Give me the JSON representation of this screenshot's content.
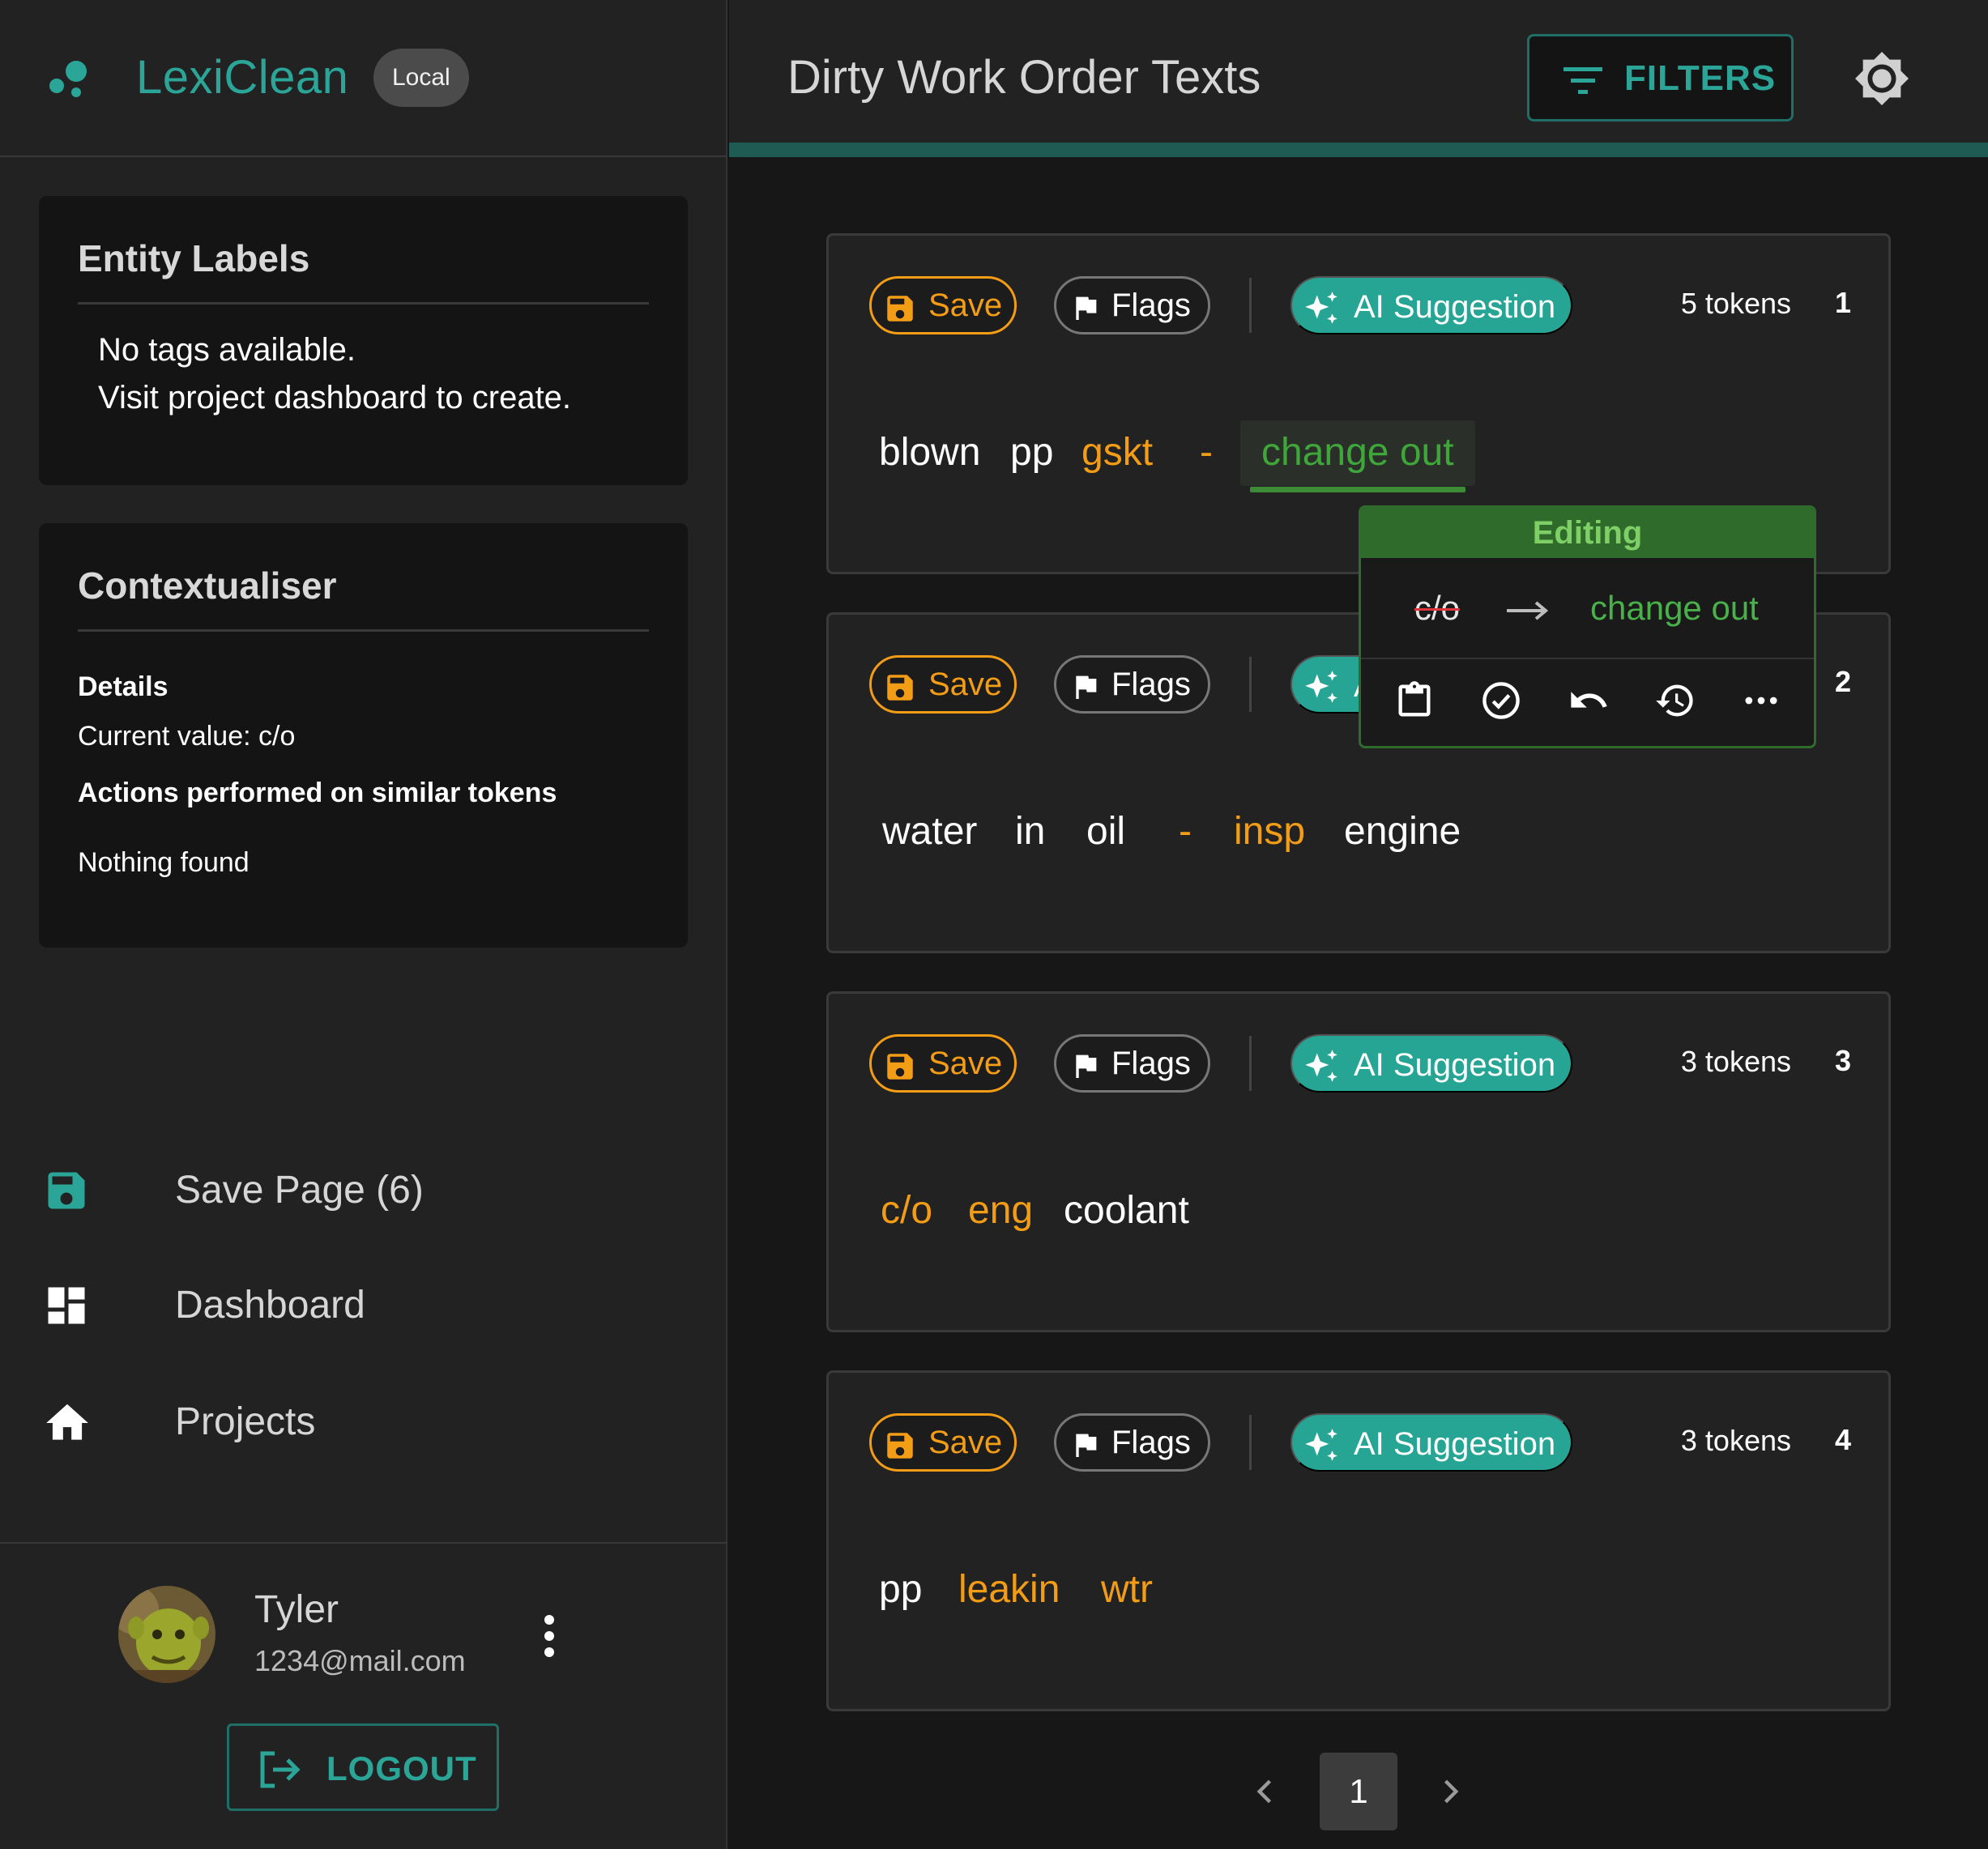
{
  "app": {
    "name": "LexiClean",
    "badge": "Local"
  },
  "header": {
    "title": "Dirty Work Order Texts",
    "filters_label": "FILTERS"
  },
  "entity_labels": {
    "title": "Entity Labels",
    "message_line1": "No tags available.",
    "message_line2": "Visit project dashboard to create."
  },
  "contextualiser": {
    "title": "Contextualiser",
    "details_heading": "Details",
    "current_value": "Current value: c/o",
    "actions_heading": "Actions performed on similar tokens",
    "actions_result": "Nothing found"
  },
  "nav": {
    "save_page": "Save Page (6)",
    "dashboard": "Dashboard",
    "projects": "Projects"
  },
  "user": {
    "name": "Tyler",
    "email": "1234@mail.com",
    "logout_label": "LOGOUT"
  },
  "card_labels": {
    "save": "Save",
    "flags": "Flags",
    "ai": "AI Suggestion"
  },
  "texts": [
    {
      "index": "1",
      "token_count": "5 tokens",
      "tokens": [
        {
          "text": "blown",
          "state": "normal"
        },
        {
          "text": "pp",
          "state": "normal"
        },
        {
          "text": "gskt",
          "state": "candidate"
        },
        {
          "text": "-",
          "state": "candidate"
        },
        {
          "text": "change out",
          "state": "editing"
        }
      ]
    },
    {
      "index": "2",
      "token_count": "",
      "tokens": [
        {
          "text": "water",
          "state": "normal"
        },
        {
          "text": "in",
          "state": "normal"
        },
        {
          "text": "oil",
          "state": "normal"
        },
        {
          "text": "-",
          "state": "candidate"
        },
        {
          "text": "insp",
          "state": "candidate"
        },
        {
          "text": "engine",
          "state": "normal"
        }
      ]
    },
    {
      "index": "3",
      "token_count": "3 tokens",
      "tokens": [
        {
          "text": "c/o",
          "state": "candidate"
        },
        {
          "text": "eng",
          "state": "candidate"
        },
        {
          "text": "coolant",
          "state": "normal"
        }
      ]
    },
    {
      "index": "4",
      "token_count": "3 tokens",
      "tokens": [
        {
          "text": "pp",
          "state": "normal"
        },
        {
          "text": "leakin",
          "state": "candidate"
        },
        {
          "text": "wtr",
          "state": "candidate"
        }
      ]
    }
  ],
  "editor": {
    "title": "Editing",
    "original": "c/o",
    "replacement": "change out",
    "actions": [
      "clipboard-icon",
      "check-circle-icon",
      "undo-icon",
      "history-icon",
      "more-horizontal-icon"
    ]
  },
  "pagination": {
    "current_page": "1"
  },
  "colors": {
    "accent": "#2ba597",
    "candidate_token": "#f39c16",
    "editing_token": "#49b04a",
    "header_bar": "#1f5a53"
  }
}
